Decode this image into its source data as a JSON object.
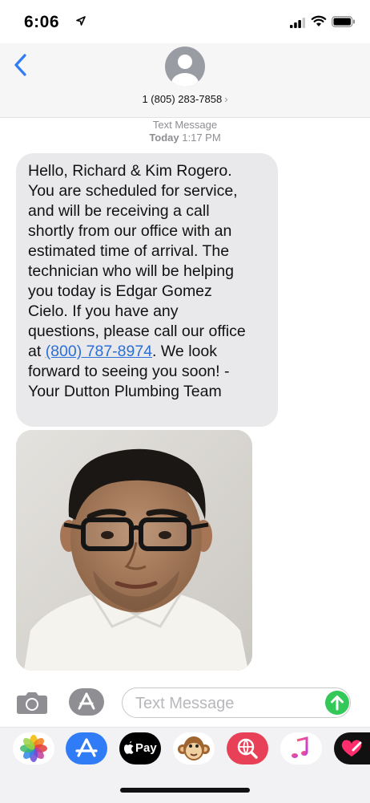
{
  "status_bar": {
    "time": "6:06"
  },
  "conversation": {
    "contact_number": "1 (805) 283-7858",
    "timestamp_label": "Text Message",
    "timestamp_day": "Today",
    "timestamp_time": "1:17 PM"
  },
  "message": {
    "lines": [
      "Hello, Richard & Kim Rogero.",
      "You are scheduled for service,",
      "and will be receiving a call",
      "shortly from our office with an",
      "estimated time of arrival. The",
      "technician who will be helping",
      "you today is Edgar Gomez",
      "Cielo. If you have any",
      "questions, please call our office"
    ],
    "line10_prefix": "at ",
    "phone_link": "(800) 787-8974",
    "line10_suffix": ". We look",
    "lines_end": [
      "forward to seeing you soon! -",
      "Your Dutton Plumbing Team"
    ]
  },
  "composer": {
    "placeholder": "Text Message"
  },
  "app_tray": {
    "apple_pay_label": "Pay",
    "apps": [
      "photos",
      "app-store",
      "apple-pay",
      "animoji",
      "web-images",
      "music",
      "digital-touch"
    ]
  },
  "colors": {
    "link": "#2a6fd6",
    "send": "#34c759",
    "back": "#2f7cf6",
    "bubble": "#e9e9eb"
  }
}
